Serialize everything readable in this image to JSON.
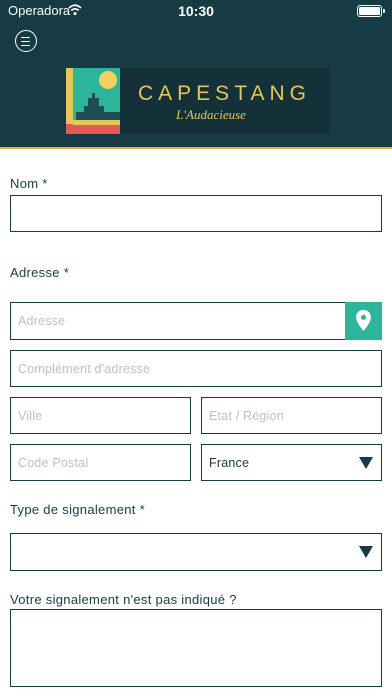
{
  "status_bar": {
    "carrier": "Operadora",
    "time": "10:30"
  },
  "logo": {
    "title": "CAPESTANG",
    "subtitle": "L'Audacieuse"
  },
  "form": {
    "name": {
      "label": "Nom *",
      "value": ""
    },
    "address_section_label": "Adresse *",
    "address": {
      "placeholder": "Adresse"
    },
    "address_complement": {
      "placeholder": "Complément d'adresse"
    },
    "city": {
      "placeholder": "Ville"
    },
    "state": {
      "placeholder": "Etat / Région"
    },
    "postal_code": {
      "placeholder": "Code Postal"
    },
    "country": {
      "value": "France"
    },
    "report_type": {
      "label": "Type de signalement *",
      "value": ""
    },
    "unlisted_report": {
      "label": "Votre signalement n'est pas indiqué ?",
      "value": ""
    }
  },
  "colors": {
    "header": "#173b44",
    "accent_gold": "#d9b43c",
    "location_button": "#2bb59a"
  },
  "icons": {
    "menu": "menu-icon",
    "location": "location-pin-icon",
    "wifi": "wifi-icon",
    "battery": "battery-icon"
  }
}
